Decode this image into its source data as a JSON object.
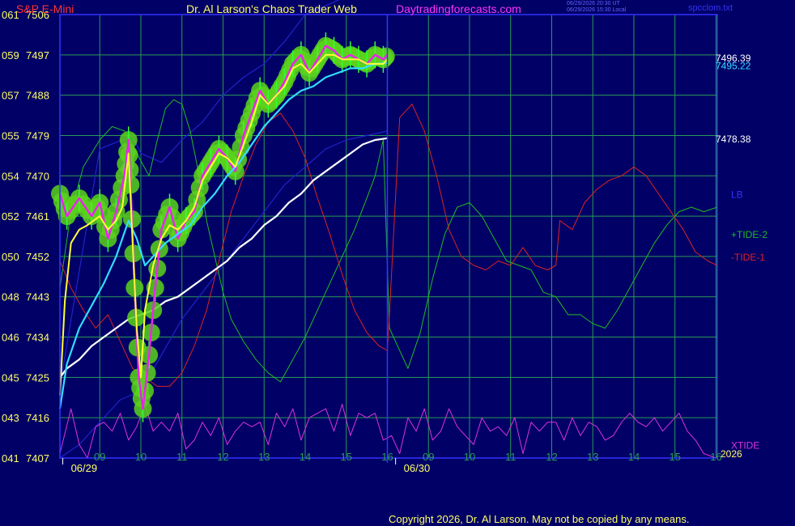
{
  "header": {
    "instrument": "S&P E-Mini",
    "title": "Dr. Al Larson's Chaos Trader Web",
    "site": "Daytradingforecasts.com",
    "stamp_utc": "06/29/2026 20:30 UT",
    "stamp_local": "06/29/2026 15:30 Local",
    "file": "spcclom.txt"
  },
  "footer": {
    "copyright": "Copyright 2026, Dr. Al Larson. May not be copied by any means."
  },
  "colors": {
    "background": "#000066",
    "grid": "#2a9b55",
    "frame": "#3333ff",
    "price_glow": "#5bd21c",
    "price_core": "#ee22ee",
    "ma_fast": "#ffff33",
    "ma_mid": "#33ddff",
    "ma_slow": "#ffffff",
    "band": "#2222cc",
    "tide_plus": "#22bb22",
    "tide_minus": "#dd2222",
    "xtide": "#dd33dd",
    "axis_text": "#ffff66",
    "header_red": "#ff3333",
    "header_magenta": "#ff33ff"
  },
  "chart_data": {
    "type": "line",
    "title": "S&P E-Mini",
    "y_left_labels": [
      {
        "left": "061",
        "right": "7506"
      },
      {
        "left": "059",
        "right": "7497"
      },
      {
        "left": "057",
        "right": "7488"
      },
      {
        "left": "055",
        "right": "7479"
      },
      {
        "left": "054",
        "right": "7470"
      },
      {
        "left": "052",
        "right": "7461"
      },
      {
        "left": "050",
        "right": "7452"
      },
      {
        "left": "048",
        "right": "7443"
      },
      {
        "left": "046",
        "right": "7434"
      },
      {
        "left": "045",
        "right": "7425"
      },
      {
        "left": "043",
        "right": "7416"
      },
      {
        "left": "041",
        "right": "7407"
      }
    ],
    "ylim": [
      7407,
      7506
    ],
    "x_hour_labels": [
      "09",
      "10",
      "11",
      "12",
      "13",
      "14",
      "15",
      "16",
      "09",
      "10",
      "11",
      "12",
      "13",
      "14",
      "15",
      "16"
    ],
    "x_hours_domain": [
      8.03,
      24.03
    ],
    "x_session_divider": 16.0,
    "date_labels": [
      {
        "text": "06/29",
        "x": 8.5
      },
      {
        "text": "06/30",
        "x": 16.6
      }
    ],
    "year": "2026",
    "right_values": [
      {
        "text": "7496.39",
        "value": 7496.39,
        "color": "#ffffff"
      },
      {
        "text": "7495.22",
        "value": 7495.22,
        "color": "#33ddff"
      },
      {
        "text": "7478.38",
        "value": 7478.38,
        "color": "#ffffff"
      }
    ],
    "legend": [
      {
        "label": "LB",
        "color": "#3333ff"
      },
      {
        "label": "+TIDE-2",
        "color": "#22bb22"
      },
      {
        "label": "-TIDE-1",
        "color": "#dd2222"
      },
      {
        "label": "XTIDE",
        "color": "#dd33dd"
      }
    ],
    "series": [
      {
        "name": "price",
        "x": [
          8.03,
          8.2,
          8.5,
          8.8,
          9.0,
          9.2,
          9.4,
          9.6,
          9.7,
          9.75,
          9.85,
          9.95,
          10.05,
          10.2,
          10.35,
          10.5,
          10.7,
          10.9,
          11.1,
          11.3,
          11.5,
          11.7,
          11.9,
          12.1,
          12.3,
          12.5,
          12.7,
          12.9,
          13.1,
          13.3,
          13.5,
          13.7,
          13.9,
          14.1,
          14.3,
          14.5,
          14.7,
          14.9,
          15.1,
          15.3,
          15.5,
          15.7,
          15.9,
          16.0
        ],
        "y": [
          7466,
          7461,
          7465,
          7461,
          7464,
          7456,
          7462,
          7470,
          7478,
          7468,
          7445,
          7425,
          7418,
          7430,
          7445,
          7458,
          7463,
          7456,
          7460,
          7462,
          7470,
          7473,
          7476,
          7474,
          7471,
          7479,
          7484,
          7489,
          7486,
          7488,
          7491,
          7495,
          7497,
          7493,
          7496,
          7499,
          7498,
          7496,
          7497,
          7496,
          7495,
          7497,
          7496,
          7497
        ]
      },
      {
        "name": "yellow average",
        "x": [
          8.03,
          8.15,
          8.3,
          8.5,
          8.7,
          9.0,
          9.2,
          9.4,
          9.55,
          9.7,
          9.8,
          9.9,
          10.0,
          10.1,
          10.3,
          10.5,
          10.7,
          10.9,
          11.1,
          11.3,
          11.5,
          11.7,
          11.9,
          12.1,
          12.3,
          12.5,
          12.7,
          12.9,
          13.1,
          13.3,
          13.5,
          13.7,
          13.9,
          14.1,
          14.3,
          14.5,
          14.7,
          14.9,
          15.1,
          15.3,
          15.5,
          15.7,
          15.9,
          16.0
        ],
        "y": [
          7421,
          7442,
          7455,
          7458,
          7459,
          7461,
          7458,
          7460,
          7463,
          7475,
          7455,
          7436,
          7425,
          7440,
          7450,
          7456,
          7459,
          7458,
          7460,
          7463,
          7469,
          7472,
          7475,
          7474,
          7472,
          7477,
          7482,
          7488,
          7486,
          7488,
          7490,
          7494,
          7495,
          7493,
          7495,
          7497,
          7497,
          7496,
          7496,
          7496,
          7495,
          7495,
          7495,
          7496
        ]
      },
      {
        "name": "cyan average",
        "x": [
          8.03,
          8.2,
          8.5,
          8.8,
          9.1,
          9.4,
          9.7,
          9.9,
          10.1,
          10.3,
          10.6,
          10.9,
          11.2,
          11.5,
          11.8,
          12.1,
          12.4,
          12.7,
          13.0,
          13.3,
          13.6,
          13.9,
          14.2,
          14.5,
          14.8,
          15.1,
          15.4,
          15.7,
          16.0
        ],
        "y": [
          7418,
          7428,
          7436,
          7441,
          7446,
          7452,
          7460,
          7456,
          7450,
          7452,
          7455,
          7457,
          7459,
          7463,
          7466,
          7470,
          7473,
          7477,
          7481,
          7484,
          7487,
          7489,
          7490,
          7492,
          7493,
          7494,
          7494,
          7495,
          7495.2
        ]
      },
      {
        "name": "white average",
        "x": [
          8.03,
          8.2,
          8.5,
          8.8,
          9.1,
          9.4,
          9.7,
          10.0,
          10.3,
          10.6,
          10.9,
          11.2,
          11.5,
          11.8,
          12.1,
          12.4,
          12.7,
          13.0,
          13.3,
          13.6,
          13.9,
          14.2,
          14.5,
          14.8,
          15.1,
          15.4,
          15.7,
          16.0
        ],
        "y": [
          7425,
          7427,
          7429,
          7432,
          7434,
          7436,
          7438,
          7439,
          7440,
          7442,
          7443,
          7445,
          7447,
          7449,
          7451,
          7454,
          7456,
          7459,
          7461,
          7464,
          7466,
          7469,
          7471,
          7473,
          7475,
          7477,
          7478,
          7478.4
        ]
      },
      {
        "name": "upper band",
        "x": [
          8.03,
          9.0,
          9.8,
          10.0,
          10.5,
          11.0,
          11.5,
          12.0,
          12.5,
          13.0,
          13.5,
          14.0,
          14.5,
          15.0
        ],
        "y": [
          7423,
          7476,
          7479,
          7475,
          7473,
          7478,
          7482,
          7488,
          7492,
          7495,
          7500,
          7506,
          7508,
          7510
        ]
      },
      {
        "name": "lower band",
        "x": [
          8.03,
          8.5,
          9.0,
          9.5,
          10.0,
          10.5,
          11.0,
          11.5,
          12.0,
          12.5,
          13.0,
          13.5,
          14.0,
          14.5,
          15.0,
          15.5,
          16.0
        ],
        "y": [
          7407,
          7410,
          7415,
          7420,
          7422,
          7430,
          7438,
          7444,
          7450,
          7456,
          7462,
          7468,
          7472,
          7476,
          7478,
          7479,
          7480
        ]
      },
      {
        "name": "+TIDE-2",
        "x": [
          8.03,
          8.3,
          8.6,
          9.0,
          9.3,
          9.6,
          9.9,
          10.2,
          10.4,
          10.6,
          10.8,
          11.0,
          11.2,
          11.4,
          11.6,
          11.8,
          12.0,
          12.2,
          12.5,
          12.8,
          13.1,
          13.4,
          13.7,
          14.0,
          14.3,
          14.6,
          14.9,
          15.2,
          15.5,
          15.7,
          15.9,
          16.05,
          16.2,
          16.5,
          16.8,
          17.1,
          17.4,
          17.7,
          18.0,
          18.3,
          18.6,
          18.9,
          19.2,
          19.5,
          19.8,
          20.1,
          20.4,
          20.7,
          21.0,
          21.3,
          21.6,
          21.9,
          22.2,
          22.5,
          22.8,
          23.1,
          23.4,
          23.7,
          24.03
        ],
        "y": [
          7445,
          7462,
          7472,
          7478,
          7481,
          7480,
          7475,
          7470,
          7478,
          7485,
          7487,
          7486,
          7480,
          7471,
          7460,
          7452,
          7444,
          7438,
          7433,
          7429,
          7426,
          7424,
          7429,
          7434,
          7440,
          7446,
          7452,
          7458,
          7465,
          7470,
          7478,
          7436,
          7433,
          7427,
          7435,
          7447,
          7457,
          7463,
          7464,
          7461,
          7456,
          7451,
          7450,
          7449,
          7444,
          7443,
          7439,
          7439,
          7437,
          7436,
          7440,
          7445,
          7450,
          7455,
          7459,
          7462,
          7463,
          7462,
          7463
        ]
      },
      {
        "name": "-TIDE-1",
        "x": [
          8.03,
          8.3,
          8.6,
          8.9,
          9.2,
          9.5,
          9.8,
          10.1,
          10.4,
          10.7,
          11.0,
          11.3,
          11.6,
          11.9,
          12.2,
          12.5,
          12.8,
          13.1,
          13.4,
          13.7,
          14.0,
          14.3,
          14.6,
          14.9,
          15.2,
          15.5,
          15.8,
          16.0,
          16.05,
          16.3,
          16.6,
          16.9,
          17.2,
          17.5,
          17.8,
          18.1,
          18.4,
          18.7,
          19.0,
          19.3,
          19.6,
          19.9,
          20.1,
          20.2,
          20.5,
          20.8,
          21.1,
          21.4,
          21.7,
          22.0,
          22.3,
          22.6,
          22.9,
          23.2,
          23.5,
          23.8,
          24.03
        ],
        "y": [
          7451,
          7445,
          7440,
          7436,
          7439,
          7433,
          7427,
          7425,
          7423,
          7423,
          7426,
          7432,
          7440,
          7451,
          7462,
          7470,
          7477,
          7482,
          7484,
          7480,
          7474,
          7465,
          7457,
          7448,
          7440,
          7435,
          7432,
          7431,
          7439,
          7483,
          7486,
          7480,
          7470,
          7458,
          7452,
          7450,
          7449,
          7451,
          7450,
          7454,
          7450,
          7449,
          7450,
          7460,
          7458,
          7464,
          7467,
          7469,
          7470,
          7472,
          7470,
          7466,
          7462,
          7458,
          7453,
          7451,
          7450
        ]
      },
      {
        "name": "XTIDE",
        "x": [
          8.03,
          8.3,
          8.5,
          8.7,
          8.9,
          9.1,
          9.3,
          9.5,
          9.7,
          9.9,
          10.1,
          10.3,
          10.5,
          10.7,
          10.9,
          11.1,
          11.3,
          11.5,
          11.7,
          11.9,
          12.1,
          12.3,
          12.5,
          12.7,
          12.9,
          13.1,
          13.3,
          13.5,
          13.7,
          13.9,
          14.1,
          14.3,
          14.5,
          14.7,
          14.9,
          15.1,
          15.3,
          15.5,
          15.7,
          15.9,
          16.1,
          16.3,
          16.5,
          16.7,
          16.9,
          17.1,
          17.3,
          17.5,
          17.7,
          17.9,
          18.1,
          18.3,
          18.5,
          18.7,
          18.9,
          19.1,
          19.3,
          19.5,
          19.7,
          19.9,
          20.1,
          20.3,
          20.5,
          20.7,
          20.9,
          21.1,
          21.3,
          21.5,
          21.7,
          21.9,
          22.1,
          22.3,
          22.5,
          22.7,
          22.9,
          23.1,
          23.3,
          23.5,
          23.7,
          24.0
        ],
        "y": [
          7408,
          7418,
          7410,
          7407,
          7414,
          7415,
          7413,
          7417,
          7411,
          7414,
          7419,
          7413,
          7415,
          7413,
          7417,
          7409,
          7411,
          7415,
          7412,
          7416,
          7410,
          7413,
          7415,
          7414,
          7415,
          7410,
          7417,
          7414,
          7418,
          7411,
          7416,
          7417,
          7418,
          7413,
          7419,
          7412,
          7417,
          7416,
          7417,
          7411,
          7412,
          7408,
          7416,
          7413,
          7418,
          7411,
          7413,
          7418,
          7414,
          7412,
          7410,
          7416,
          7413,
          7414,
          7412,
          7416,
          7408,
          7415,
          7413,
          7415,
          7415,
          7411,
          7416,
          7412,
          7415,
          7414,
          7411,
          7412,
          7415,
          7417,
          7415,
          7414,
          7416,
          7413,
          7415,
          7417,
          7413,
          7411,
          7408,
          7407
        ]
      }
    ]
  }
}
